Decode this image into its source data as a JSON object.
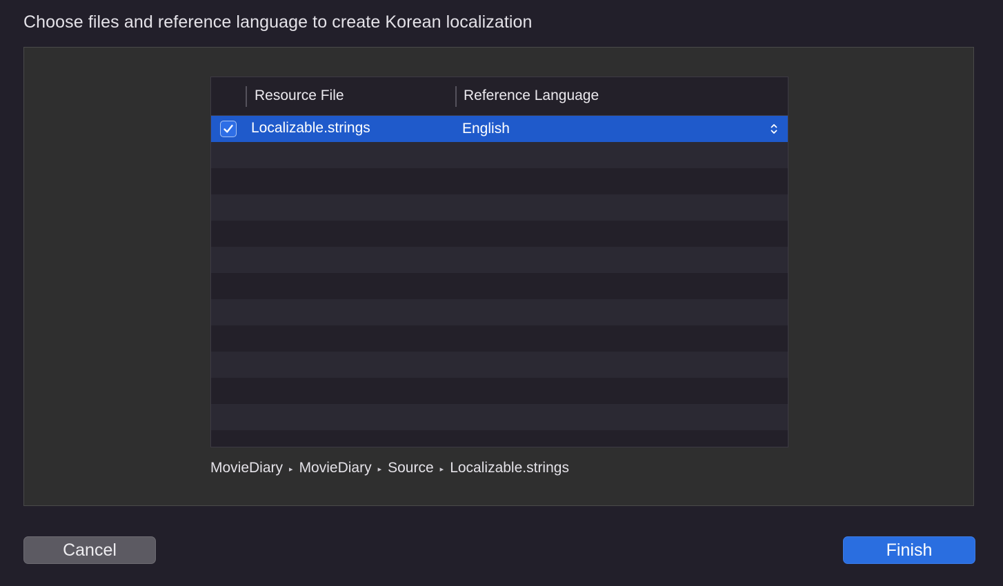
{
  "dialog": {
    "title": "Choose files and reference language to create Korean localization"
  },
  "table": {
    "columns": [
      "Resource File",
      "Reference Language"
    ],
    "rows": [
      {
        "checked": true,
        "file": "Localizable.strings",
        "language": "English",
        "selected": true
      }
    ]
  },
  "path": {
    "segments": [
      "MovieDiary",
      "MovieDiary",
      "Source",
      "Localizable.strings"
    ],
    "separator": "▸"
  },
  "buttons": {
    "cancel": "Cancel",
    "finish": "Finish"
  },
  "colors": {
    "background": "#221f2a",
    "panel": "#2f2f2f",
    "selection": "#1f5acb",
    "accent": "#2a6ee0"
  }
}
